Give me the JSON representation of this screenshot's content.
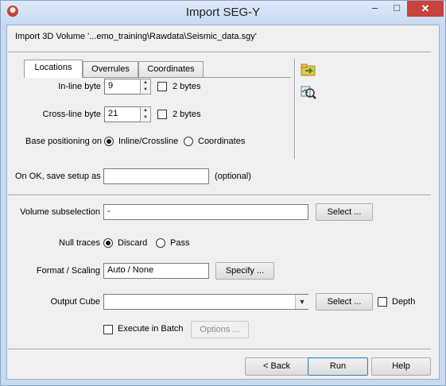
{
  "window": {
    "title": "Import SEG-Y",
    "minimize": "‒",
    "maximize": "□",
    "close": "✕"
  },
  "header": {
    "input_path": "Import 3D Volume '...emo_training\\Rawdata\\Seismic_data.sgy'"
  },
  "tabs": [
    {
      "label": "Locations",
      "active": true
    },
    {
      "label": "Overrules",
      "active": false
    },
    {
      "label": "Coordinates",
      "active": false
    }
  ],
  "locations": {
    "inline_label": "In-line byte",
    "inline_value": "9",
    "inline_2bytes_label": "2 bytes",
    "inline_2bytes_checked": false,
    "crossline_label": "Cross-line byte",
    "crossline_value": "21",
    "crossline_2bytes_label": "2 bytes",
    "crossline_2bytes_checked": false,
    "base_label": "Base positioning on",
    "base_options": [
      "Inline/Crossline",
      "Coordinates"
    ],
    "base_selected": "Inline/Crossline"
  },
  "tool_icons": [
    "folder-arrow-icon",
    "magnify-scan-icon"
  ],
  "save_setup": {
    "label": "On OK, save setup as",
    "value": "",
    "hint": "(optional)"
  },
  "volume": {
    "label": "Volume subselection",
    "value": "-",
    "button": "Select ..."
  },
  "null_traces": {
    "label": "Null traces",
    "options": [
      "Discard",
      "Pass"
    ],
    "selected": "Discard"
  },
  "format": {
    "label": "Format / Scaling",
    "value": "Auto / None",
    "button": "Specify ..."
  },
  "output": {
    "label": "Output Cube",
    "value": "",
    "button": "Select ...",
    "depth_label": "Depth",
    "depth_checked": false
  },
  "batch": {
    "label": "Execute in Batch",
    "checked": false,
    "options_button": "Options ..."
  },
  "footer": {
    "back": "< Back",
    "run": "Run",
    "help": "Help"
  },
  "colors": {
    "title_bar": "#c9dbf2",
    "close_button": "#c7433b",
    "dialog_bg": "#f0f0f0",
    "default_button_border": "#3c7fb1"
  }
}
